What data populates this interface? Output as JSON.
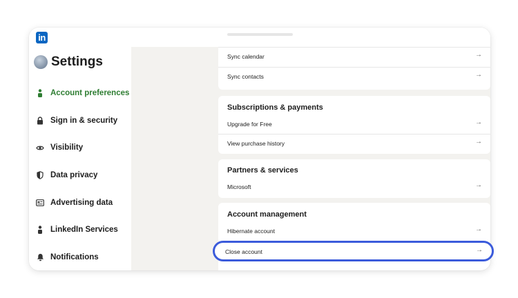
{
  "app": {
    "logo_text": "in"
  },
  "sidebar": {
    "title": "Settings",
    "items": [
      {
        "label": "Account preferences",
        "icon": "person-icon",
        "active": true
      },
      {
        "label": "Sign in & security",
        "icon": "lock-icon"
      },
      {
        "label": "Visibility",
        "icon": "eye-icon"
      },
      {
        "label": "Data privacy",
        "icon": "shield-icon"
      },
      {
        "label": "Advertising data",
        "icon": "newspaper-icon"
      },
      {
        "label": "LinkedIn Services",
        "icon": "person-icon"
      },
      {
        "label": "Notifications",
        "icon": "bell-icon"
      }
    ]
  },
  "main": {
    "sync_card": {
      "rows": [
        {
          "label": "Sync calendar"
        },
        {
          "label": "Sync contacts"
        }
      ]
    },
    "subscriptions_card": {
      "title": "Subscriptions & payments",
      "rows": [
        {
          "label": "Upgrade for Free"
        },
        {
          "label": "View purchase history"
        }
      ]
    },
    "partners_card": {
      "title": "Partners & services",
      "rows": [
        {
          "label": "Microsoft"
        }
      ]
    },
    "account_management_card": {
      "title": "Account management",
      "rows": [
        {
          "label": "Hibernate account"
        },
        {
          "label": "Close account",
          "highlighted": true
        }
      ]
    },
    "arrow_glyph": "→"
  },
  "colors": {
    "accent_active": "#2e7d32",
    "highlight_border": "#3b5bdb",
    "brand": "#0a66c2",
    "background": "#f3f2ef"
  }
}
